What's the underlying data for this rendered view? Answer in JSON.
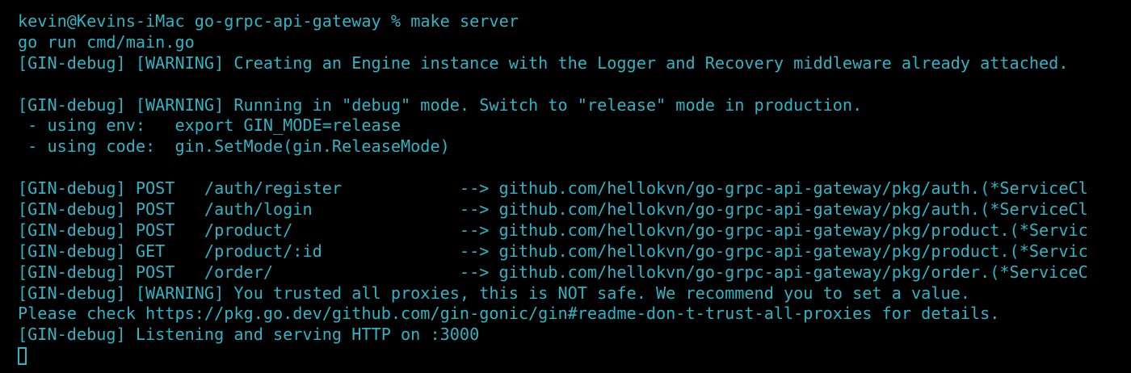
{
  "terminal": {
    "colors": {
      "background": "#000000",
      "text": "#2fb4c3"
    },
    "prompt": {
      "user_host": "kevin@Kevins-iMac",
      "directory": "go-grpc-api-gateway",
      "symbol": "%",
      "command": "make server"
    },
    "output": [
      "go run cmd/main.go",
      "[GIN-debug] [WARNING] Creating an Engine instance with the Logger and Recovery middleware already attached.",
      "",
      "[GIN-debug] [WARNING] Running in \"debug\" mode. Switch to \"release\" mode in production.",
      " - using env:   export GIN_MODE=release",
      " - using code:  gin.SetMode(gin.ReleaseMode)",
      "",
      "[GIN-debug] POST   /auth/register            --> github.com/hellokvn/go-grpc-api-gateway/pkg/auth.(*ServiceCl",
      "[GIN-debug] POST   /auth/login               --> github.com/hellokvn/go-grpc-api-gateway/pkg/auth.(*ServiceCl",
      "[GIN-debug] POST   /product/                 --> github.com/hellokvn/go-grpc-api-gateway/pkg/product.(*Servic",
      "[GIN-debug] GET    /product/:id              --> github.com/hellokvn/go-grpc-api-gateway/pkg/product.(*Servic",
      "[GIN-debug] POST   /order/                   --> github.com/hellokvn/go-grpc-api-gateway/pkg/order.(*ServiceC",
      "[GIN-debug] [WARNING] You trusted all proxies, this is NOT safe. We recommend you to set a value.",
      "Please check https://pkg.go.dev/github.com/gin-gonic/gin#readme-don-t-trust-all-proxies for details.",
      "[GIN-debug] Listening and serving HTTP on :3000"
    ]
  }
}
